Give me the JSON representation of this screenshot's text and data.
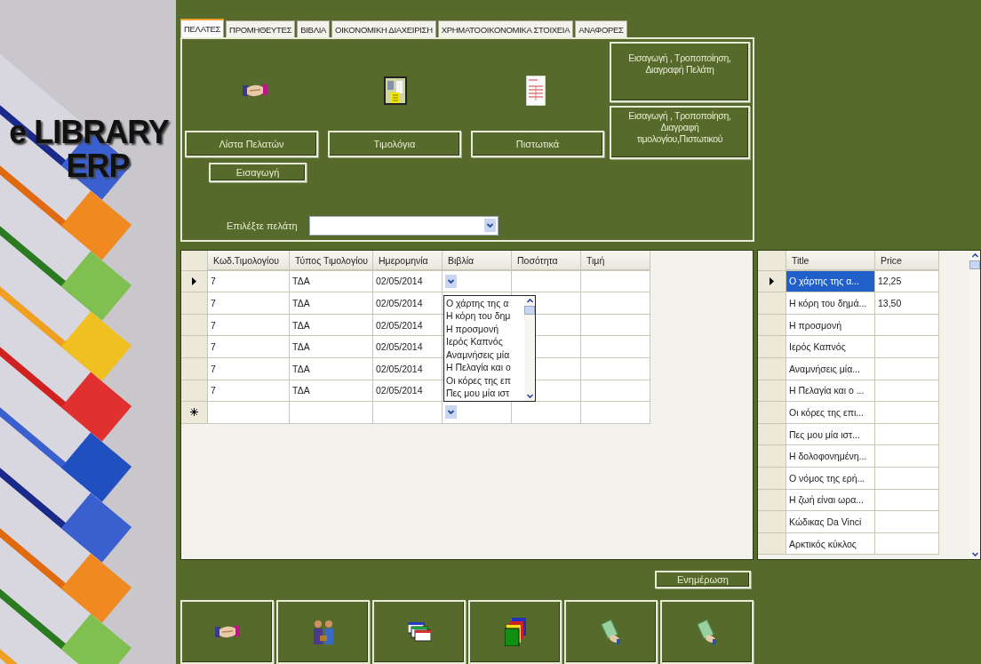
{
  "app_title": {
    "line_1": "e LIBRARY",
    "line_2": "ERP"
  },
  "tabs": [
    {
      "label": "ΠΕΛΑΤΕΣ",
      "selected": true
    },
    {
      "label": "ΠΡΟΜΗΘΕΥΤΕΣ",
      "selected": false
    },
    {
      "label": "ΒΙΒΛΙΑ",
      "selected": false
    },
    {
      "label": "ΟΙΚΟΝΟΜΙΚΗ ΔΙΑΧΕΙΡΙΣΗ",
      "selected": false
    },
    {
      "label": "ΧΡΗΜΑΤΟΟΙΚΟΝΟΜΙΚΑ ΣΤΟΙΧΕΙΑ",
      "selected": false
    },
    {
      "label": "ΑΝΑΦΟΡΕΣ",
      "selected": false
    }
  ],
  "customer_panel": {
    "actions": [
      {
        "kind": "handshake",
        "label": "Λίστα Πελατών"
      },
      {
        "kind": "calculator",
        "label": "Τιμολόγια"
      },
      {
        "kind": "document",
        "label": "Πιστωτικά"
      }
    ],
    "side_buttons": [
      "Εισαγωγή , Τροποποίηση, Διαγραφή Πελάτη",
      "Εισαγωγή , Τροποποίηση, Διαγραφή τιμολογίου,Πιστωτικού"
    ],
    "insert_button": "Εισαγωγή",
    "customer_select": {
      "label": "Επιλέξτε πελάτη"
    }
  },
  "invoice_grid": {
    "columns": [
      "Κωδ.Τιμολογίου",
      "Τύπος Τιμολογίου",
      "Ημερομηνία",
      "Βιβλία",
      "Ποσότητα",
      "Τιμή"
    ],
    "rows": [
      {
        "kind": "current",
        "cells": [
          "7",
          "ΤΔΑ",
          "02/05/2014"
        ]
      },
      {
        "kind": "normal",
        "cells": [
          "7",
          "ΤΔΑ",
          "02/05/2014"
        ]
      },
      {
        "kind": "normal",
        "cells": [
          "7",
          "ΤΔΑ",
          "02/05/2014"
        ]
      },
      {
        "kind": "normal",
        "cells": [
          "7",
          "ΤΔΑ",
          "02/05/2014"
        ]
      },
      {
        "kind": "normal",
        "cells": [
          "7",
          "ΤΔΑ",
          "02/05/2014"
        ]
      },
      {
        "kind": "normal",
        "cells": [
          "7",
          "ΤΔΑ",
          "02/05/2014"
        ]
      },
      {
        "kind": "new",
        "cells": []
      }
    ],
    "book_dropdown": {
      "items": [
        "Ο χάρτης της α",
        "Η κόρη του δημ",
        "Η προσμονή",
        "Ιερός Καπνός",
        "Αναμνήσεις μία",
        "Η Πελαγία και ο",
        "Οι κόρες της επ",
        "Πες μου μία ιστ"
      ]
    }
  },
  "books_grid": {
    "columns": [
      "Title",
      "Price"
    ],
    "rows": [
      {
        "title": "Ο χάρτης της α...",
        "price": "12,25",
        "current": true,
        "selected": true
      },
      {
        "title": "Η κόρη του δημά...",
        "price": "13,50",
        "current": false,
        "selected": false
      },
      {
        "title": "Η προσμονή",
        "current": false,
        "selected": false
      },
      {
        "title": "Ιερός Καπνός",
        "current": false,
        "selected": false
      },
      {
        "title": "Αναμνήσεις μία...",
        "current": false,
        "selected": false
      },
      {
        "title": "Η Πελαγία και ο ...",
        "current": false,
        "selected": false
      },
      {
        "title": "Οι κόρες της επι...",
        "current": false,
        "selected": false
      },
      {
        "title": "Πες μου μία ιστ...",
        "current": false,
        "selected": false
      },
      {
        "title": "Η δολοφονημένη...",
        "current": false,
        "selected": false
      },
      {
        "title": "Ο νόμος της ερή...",
        "current": false,
        "selected": false
      },
      {
        "title": "Η ζωή είναι ωρα...",
        "current": false,
        "selected": false
      },
      {
        "title": "Κώδικας Da Vinci",
        "current": false,
        "selected": false
      },
      {
        "title": "Αρκτικός κύκλος",
        "current": false,
        "selected": false
      }
    ]
  },
  "update_button": "Ενημέρωση",
  "bottom_buttons": [
    {
      "kind": "handshake"
    },
    {
      "kind": "people"
    },
    {
      "kind": "windows"
    },
    {
      "kind": "folders"
    },
    {
      "kind": "money"
    },
    {
      "kind": "money"
    }
  ]
}
